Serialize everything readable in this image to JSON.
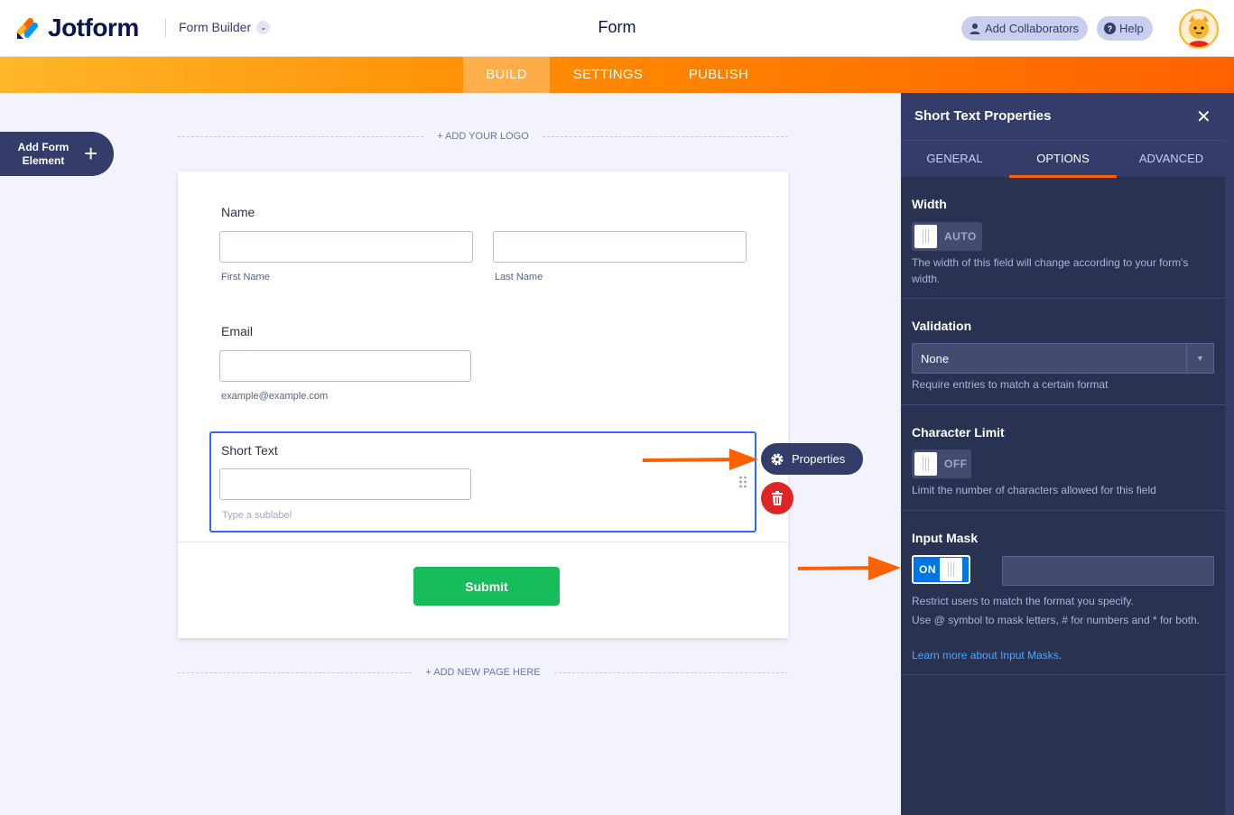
{
  "header": {
    "logo_text": "Jotform",
    "form_builder_label": "Form Builder",
    "form_title": "Form",
    "add_collaborators": "Add Collaborators",
    "help": "Help"
  },
  "nav": {
    "tabs": [
      "BUILD",
      "SETTINGS",
      "PUBLISH"
    ],
    "active": "BUILD"
  },
  "canvas": {
    "add_form_element": "Add Form Element",
    "add_logo": "+ ADD YOUR LOGO",
    "add_page": "+ ADD NEW PAGE HERE",
    "name_label": "Name",
    "first_name_sublabel": "First Name",
    "last_name_sublabel": "Last Name",
    "email_label": "Email",
    "email_sublabel": "example@example.com",
    "short_text_label": "Short Text",
    "short_text_sublabel_placeholder": "Type a sublabel",
    "submit_label": "Submit",
    "properties_label": "Properties"
  },
  "panel": {
    "title": "Short Text Properties",
    "tabs": [
      "GENERAL",
      "OPTIONS",
      "ADVANCED"
    ],
    "active_tab": "OPTIONS",
    "width": {
      "title": "Width",
      "toggle": "AUTO",
      "desc": "The width of this field will change according to your form's width."
    },
    "validation": {
      "title": "Validation",
      "selected": "None",
      "desc": "Require entries to match a certain format"
    },
    "char_limit": {
      "title": "Character Limit",
      "toggle": "OFF",
      "desc": "Limit the number of characters allowed for this field"
    },
    "input_mask": {
      "title": "Input Mask",
      "toggle": "ON",
      "desc1": "Restrict users to match the format you specify.",
      "desc2": "Use @ symbol to mask letters, # for numbers and * for both.",
      "learn_more": "Learn more about Input Masks",
      "learn_more_suffix": "."
    }
  },
  "colors": {
    "brand_orange": "#ff6100",
    "panel_bg": "#293251",
    "submit_green": "#18bd5b",
    "delete_red": "#dc2626",
    "toggle_on_blue": "#0075e3"
  }
}
